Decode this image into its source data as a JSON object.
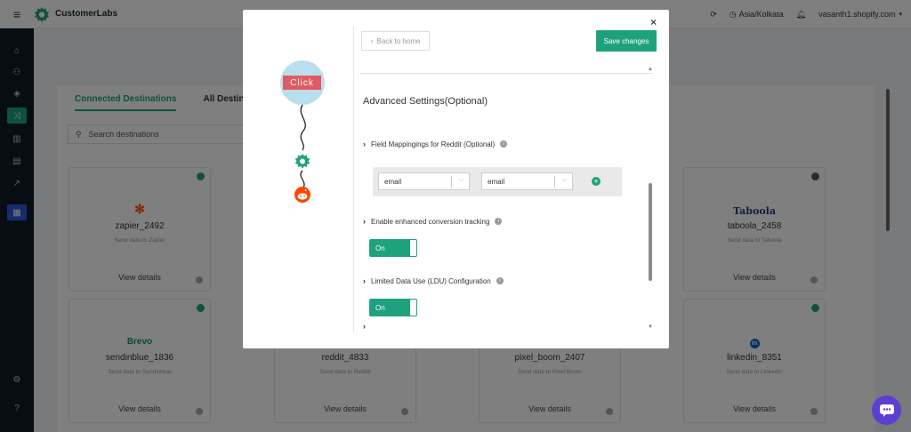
{
  "app": {
    "brand": "CustomerLabs"
  },
  "topbar": {
    "timezone": "Asia/Kolkata",
    "account": "vasanth1.shopify.com"
  },
  "tabs": {
    "connected": "Connected Destinations",
    "all": "All Destinations"
  },
  "search": {
    "placeholder": "Search destinations"
  },
  "cards": [
    {
      "logo": "✻",
      "name": "zapier_2492",
      "desc": "Send data to Zapier",
      "view": "View details"
    },
    {
      "logo": "Taboola",
      "name": "taboola_2458",
      "desc": "Send data to Taboola",
      "view": "View details"
    },
    {
      "logo": "Brevo",
      "name": "sendinblue_1836",
      "desc": "Send data to Sendinblue",
      "view": "View details"
    },
    {
      "logo": "",
      "name": "reddit_4833",
      "desc": "Send data to Reddit",
      "view": "View details"
    },
    {
      "logo": "",
      "name": "pixel_boom_2407",
      "desc": "Send data to Pixel Boom",
      "view": "View details"
    },
    {
      "logo": "in",
      "name": "linkedin_8351",
      "desc": "Send data to LinkedIn",
      "view": "View details"
    }
  ],
  "modal": {
    "close": "×",
    "back_label": "Back to home",
    "save_label": "Save changes",
    "flow_click_label": "Click",
    "advanced_title": "Advanced Settings(Optional)",
    "field_mapping_label": "Field Mappingings for Reddit (Optional)",
    "mapping_source": "email",
    "mapping_target": "email",
    "enhanced_label": "Enable enhanced conversion tracking",
    "enhanced_toggle": "On",
    "ldu_label": "Limited Data Use (LDU) Configuration",
    "ldu_toggle": "On"
  },
  "colors": {
    "accent": "#1ea27d",
    "sidebar": "#0f1d27",
    "chat": "#5b3fd1",
    "reddit": "#ff4500"
  }
}
